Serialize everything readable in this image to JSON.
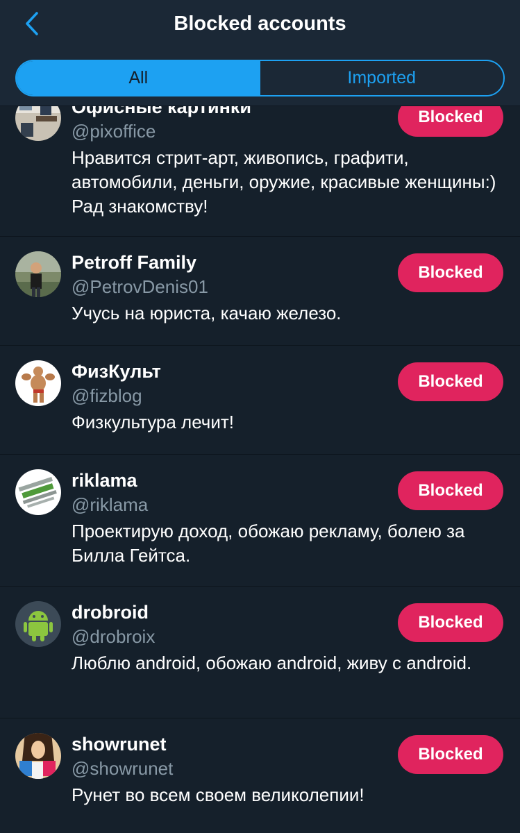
{
  "header": {
    "title": "Blocked accounts",
    "back_icon": "chevron-left-icon"
  },
  "tabs": [
    {
      "label": "All",
      "active": true
    },
    {
      "label": "Imported",
      "active": false
    }
  ],
  "colors": {
    "background": "#15202b",
    "header_bg": "#1b2836",
    "accent": "#1da1f2",
    "blocked_button": "#e0245e",
    "secondary_text": "#8899a6"
  },
  "accounts": [
    {
      "name": "Офисные картинки",
      "handle": "@pixoffice",
      "bio": "Нравится стрит-арт, живопись, графити, автомобили, деньги, оружие, красивые женщины:) Рад знакомству!",
      "button": "Blocked",
      "avatar_icon": "office-photo-avatar"
    },
    {
      "name": "Petroff Family",
      "handle": "@PetrovDenis01",
      "bio": "Учусь на юриста, качаю железо.",
      "button": "Blocked",
      "avatar_icon": "man-outdoors-avatar"
    },
    {
      "name": "ФизКульт",
      "handle": "@fizblog",
      "bio": "Физкультура лечит!",
      "button": "Blocked",
      "avatar_icon": "bodybuilder-avatar"
    },
    {
      "name": "riklama",
      "handle": "@riklama",
      "bio": "Проектирую доход, обожаю рекламу, болею за Билла Гейтса.",
      "button": "Blocked",
      "avatar_icon": "text-collage-avatar"
    },
    {
      "name": "drobroid",
      "handle": "@drobroix",
      "bio": "Люблю android, обожаю android, живу с android.",
      "button": "Blocked",
      "avatar_icon": "android-robot-avatar"
    },
    {
      "name": "showrunet",
      "handle": "@showrunet",
      "bio": "Рунет во всем своем великолепии!",
      "button": "Blocked",
      "avatar_icon": "woman-shopping-avatar"
    }
  ]
}
